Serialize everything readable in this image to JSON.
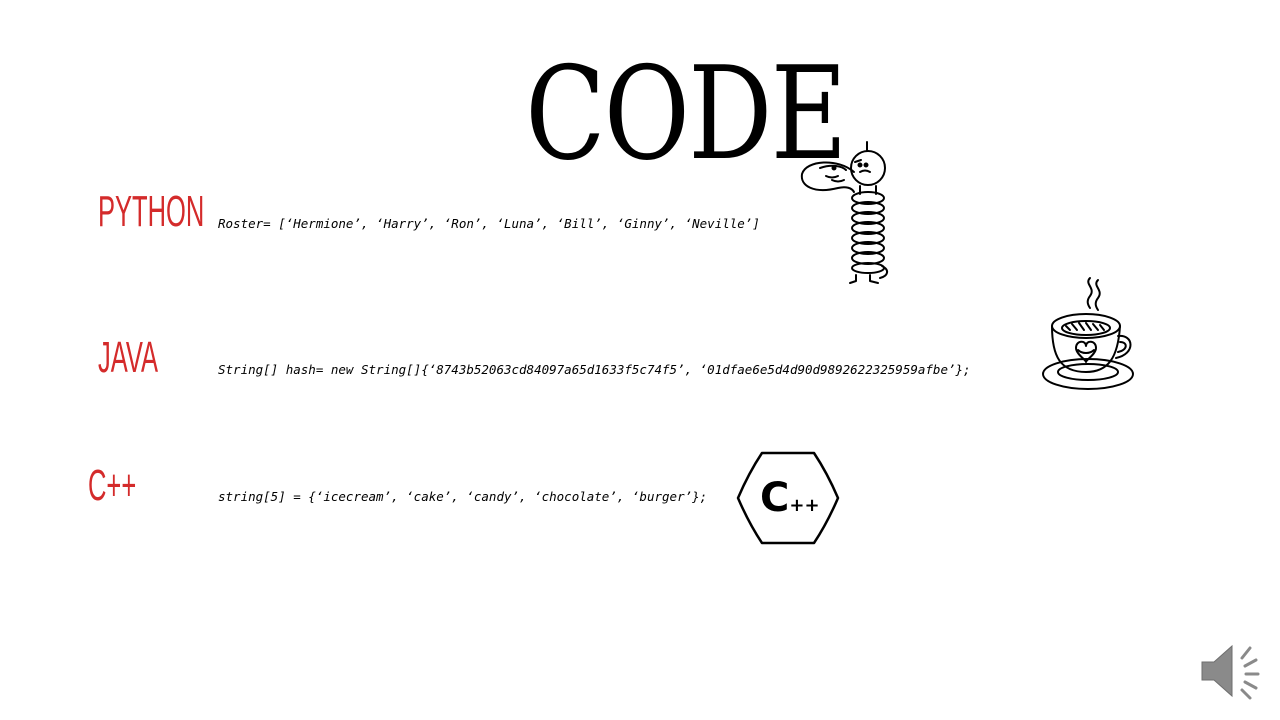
{
  "slide": {
    "title": "CODE",
    "rows": [
      {
        "language": "PYTHON",
        "code": "Roster= [‘Hermione’, ‘Harry’, ‘Ron’, ‘Luna’, ‘Bill’, ‘Ginny’, ‘Neville’]",
        "illustration": "snake-icon"
      },
      {
        "language": "JAVA",
        "code": "String[] hash= new String[]{‘8743b52063cd84097a65d1633f5c74f5’, ‘01dfae6e5d4d90d9892622325959afbe’};",
        "illustration": "coffee-cup-icon"
      },
      {
        "language": "C++",
        "code": "string[5] = {‘icecream’, ‘cake’, ‘candy’, ‘chocolate’, ‘burger’};",
        "illustration": "cpp-logo-icon"
      }
    ],
    "cpp_logo": {
      "letter": "C",
      "suffix": "++"
    }
  },
  "colors": {
    "language_label": "#d42b2b",
    "text": "#000000",
    "background": "#ffffff",
    "speaker": "#8a8a8a"
  },
  "controls": {
    "audio_icon": "speaker-icon"
  }
}
